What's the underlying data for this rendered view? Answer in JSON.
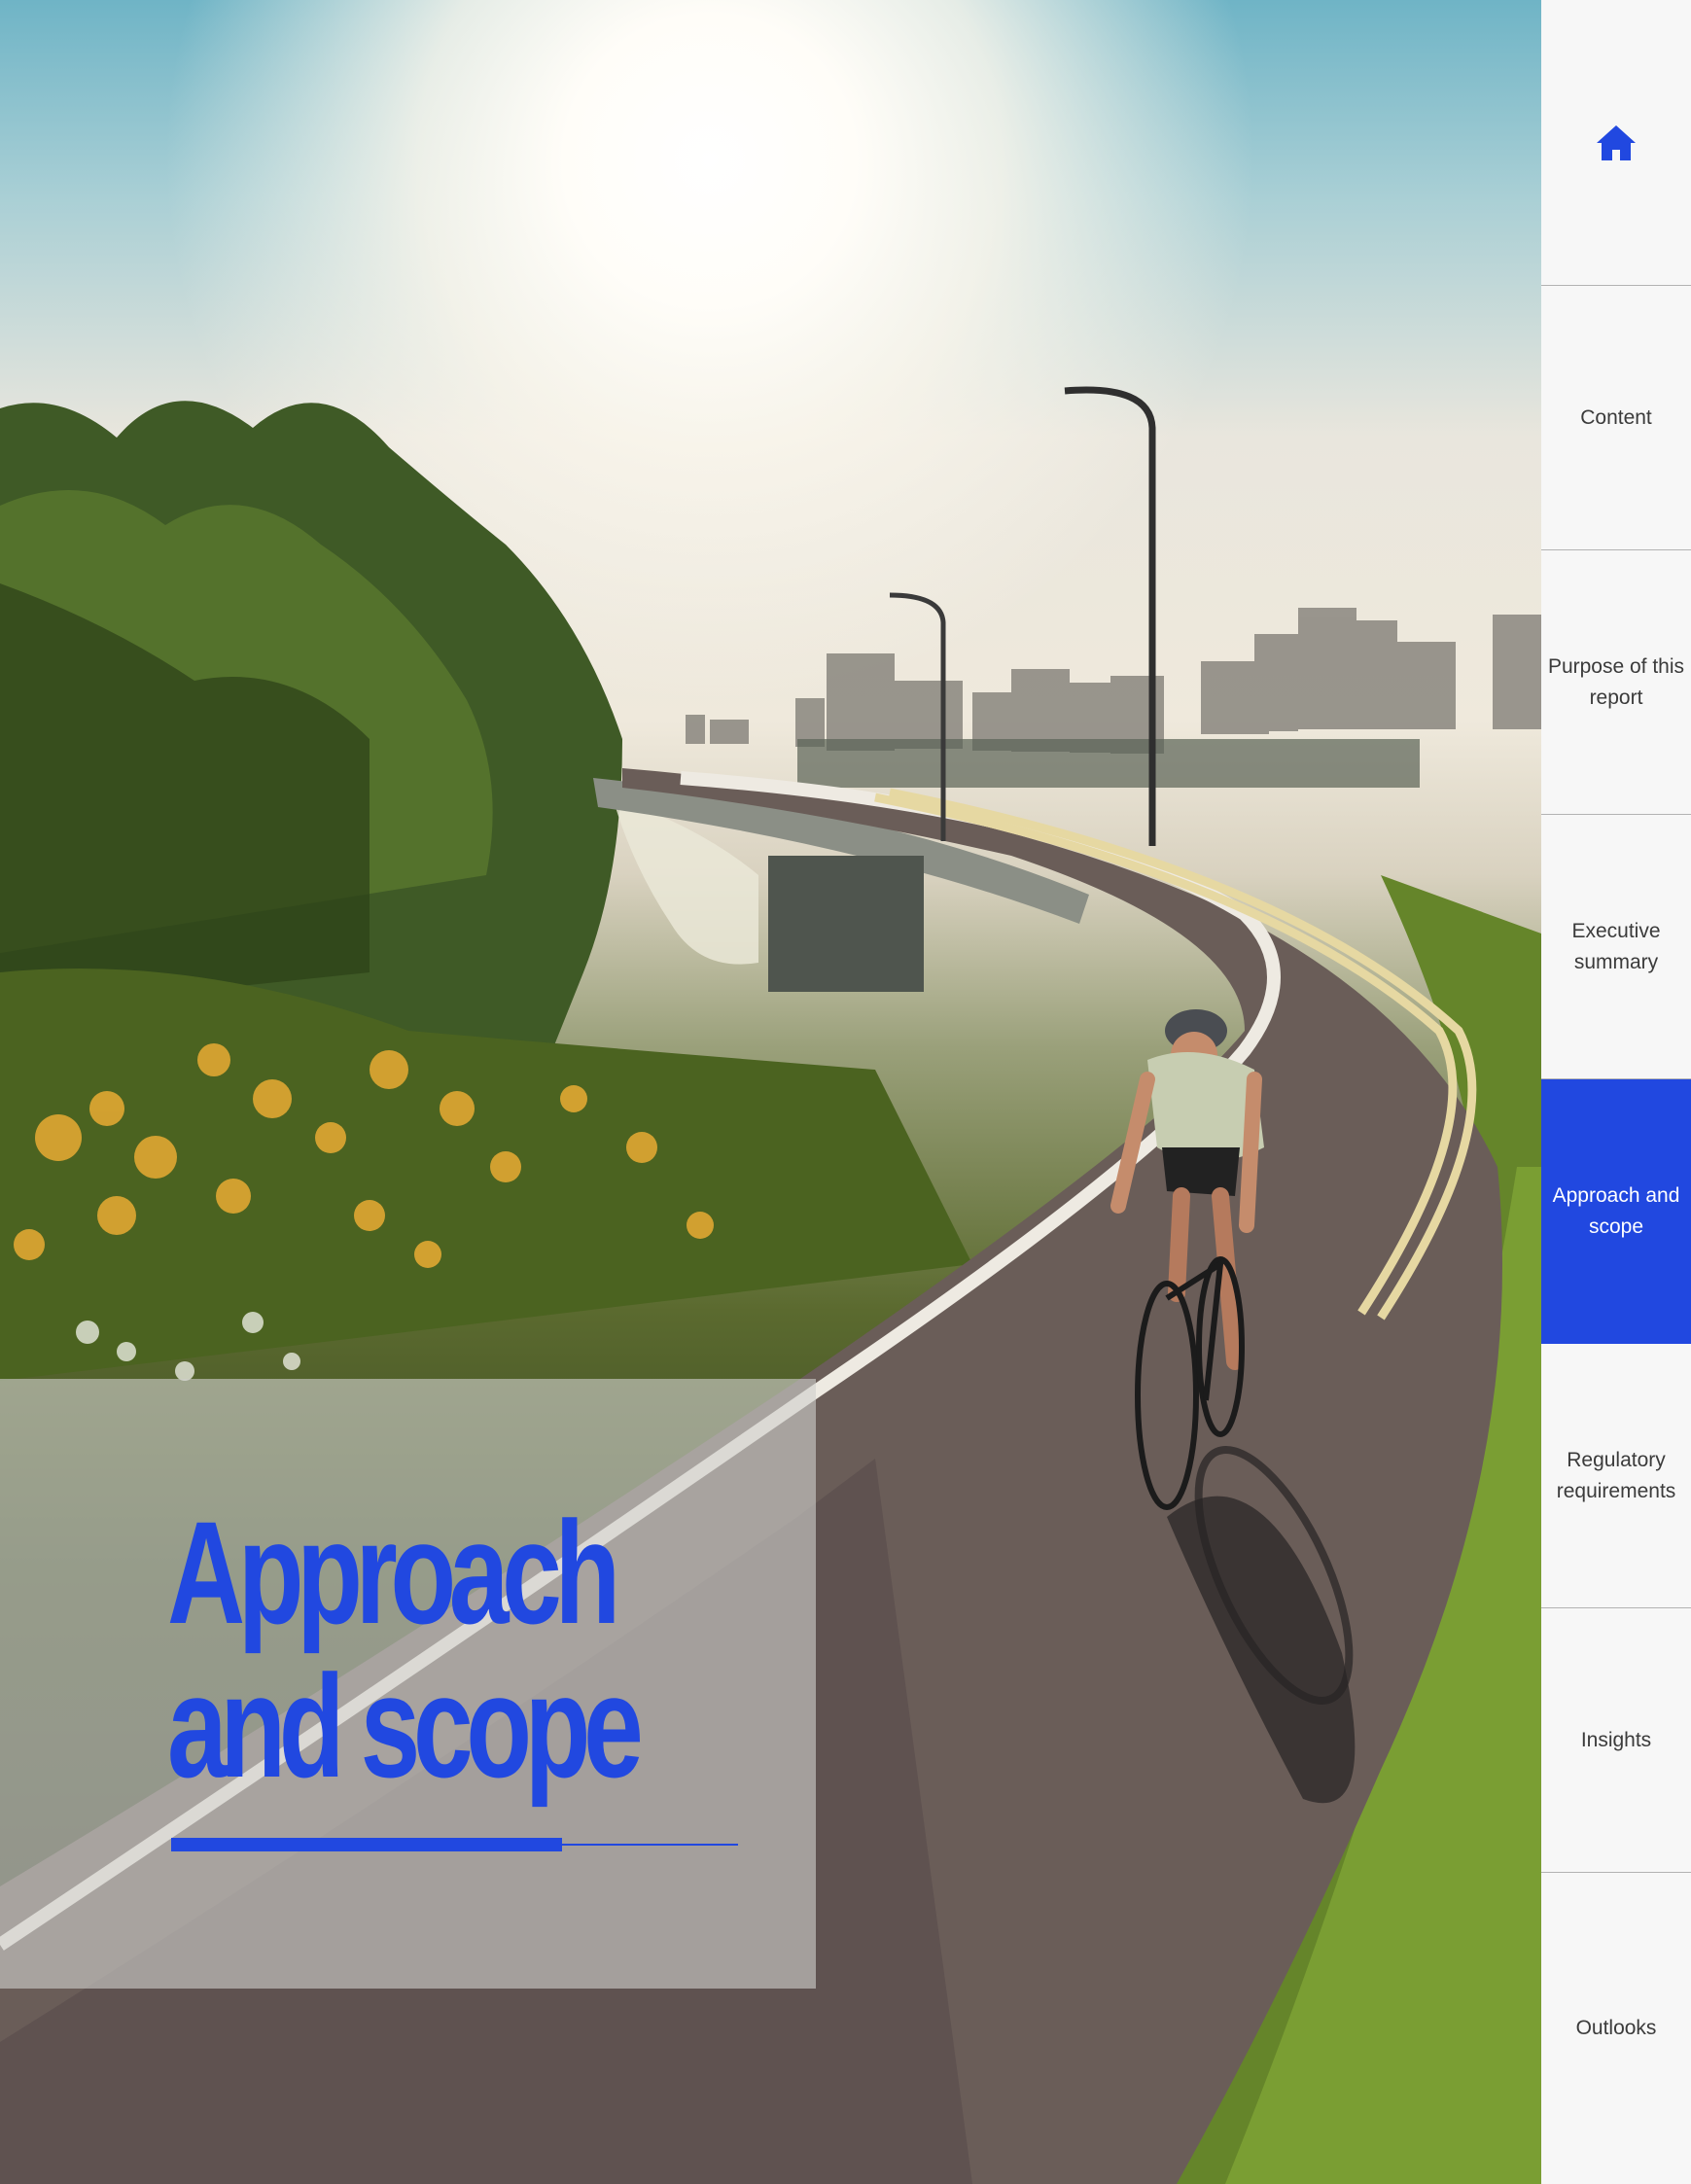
{
  "hero": {
    "image": "Cyclist riding on a curved bike path beside a road, with green bushes and yellow wildflowers, a city skyline and bright sun in the background"
  },
  "title": {
    "line1": "Approach",
    "line2": "and scope",
    "progress": 0.69
  },
  "nav": {
    "home_icon": "home-icon",
    "items": [
      {
        "label": "Content",
        "active": false
      },
      {
        "label": "Purpose of this report",
        "active": false
      },
      {
        "label": "Executive summary",
        "active": false
      },
      {
        "label": "Approach and scope",
        "active": true
      },
      {
        "label": "Regulatory requirements",
        "active": false
      },
      {
        "label": "Insights",
        "active": false
      },
      {
        "label": "Outlooks",
        "active": false
      }
    ]
  },
  "colors": {
    "accent": "#2148e0",
    "nav_background": "#f7f7f7",
    "nav_text": "#3b3b3b",
    "divider": "#b3b3b3",
    "title_panel": "#cececc"
  }
}
